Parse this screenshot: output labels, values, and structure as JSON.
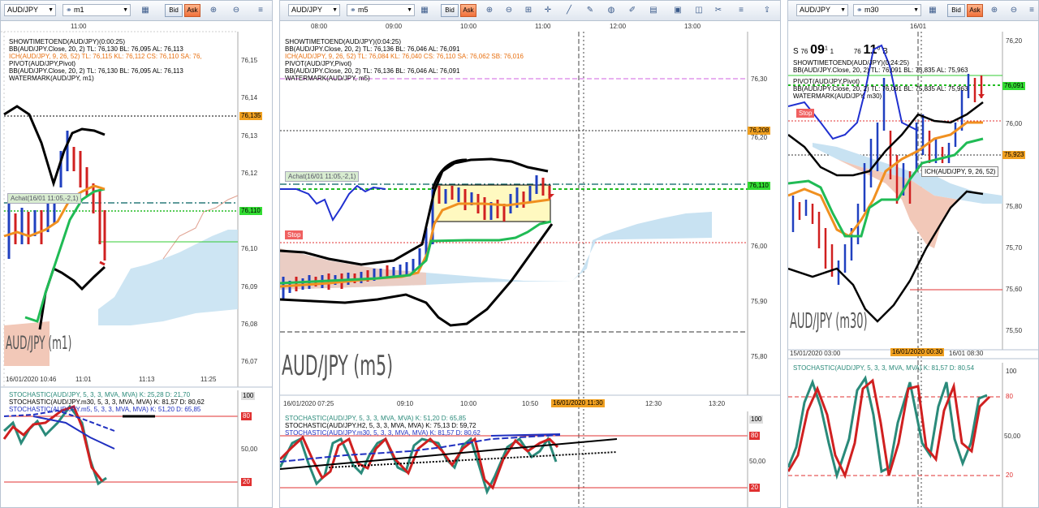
{
  "panels": [
    {
      "symbol": "AUD/JPY",
      "timeframe": "m1",
      "bid": "Bid",
      "ask": "Ask",
      "time_labels": [
        "11:00"
      ],
      "indicators": [
        {
          "text": "SHOWTIMETOEND(AUD/JPY)(0:00:25)",
          "color": "#000000"
        },
        {
          "text": "BB(AUD/JPY.Close, 20, 2)  TL: 76,130  BL: 76,095  AL: 76,113",
          "color": "#000000"
        },
        {
          "text": "ICH(AUD/JPY, 9, 26, 52)  TL: 76,115  KL: 76,112  CS: 76,110  SA: 76,",
          "color": "#e87010"
        },
        {
          "text": "PIVOT(AUD/JPY,Pivot)",
          "color": "#000000"
        },
        {
          "text": "BB(AUD/JPY.Close, 20, 2)  TL: 76,130  BL: 76,095  AL: 76,113",
          "color": "#000000"
        },
        {
          "text": "WATERMARK(AUD/JPY, m1)",
          "color": "#000000"
        }
      ],
      "price_ticks": [
        "76,15",
        "76,14",
        "76,13",
        "76,12",
        "76,11",
        "76,10",
        "76,09",
        "76,08",
        "76,07"
      ],
      "price_tags": [
        {
          "text": "76,135",
          "bg": "#f0a020"
        },
        {
          "text": "76,110",
          "bg": "#33dd33"
        }
      ],
      "achat_label": "Achat(16/01 11:05,-2,1)",
      "watermark": "AUD/JPY (m1)",
      "date_labels": [
        "16/01/2020 10:46",
        "11:01",
        "11:13",
        "11:25"
      ],
      "stoch": [
        {
          "text": "STOCHASTIC(AUD/JPY, 5, 3, 3, MVA, MVA)  K: 25,28  D: 21,70",
          "color": "#2a8a7a"
        },
        {
          "text": "STOCHASTIC(AUD/JPY.m30, 5, 3, 3, MVA, MVA)  K: 81,57  D: 80,62",
          "color": "#000000"
        },
        {
          "text": "STOCHASTIC(AUD/JPY.m5, 5, 3, 3, MVA, MVA)  K: 51,20  D: 65,85",
          "color": "#2030c0"
        }
      ],
      "stoch_ticks": [
        "100",
        "80",
        "50,00",
        "20"
      ]
    },
    {
      "symbol": "AUD/JPY",
      "timeframe": "m5",
      "bid": "Bid",
      "ask": "Ask",
      "time_labels": [
        "08:00",
        "09:00",
        "10:00",
        "11:00",
        "12:00",
        "13:00"
      ],
      "indicators": [
        {
          "text": "SHOWTIMETOEND(AUD/JPY)(0:04:25)",
          "color": "#000000"
        },
        {
          "text": "BB(AUD/JPY.Close, 20, 2)  TL: 76,136  BL: 76,046  AL: 76,091",
          "color": "#000000"
        },
        {
          "text": "ICH(AUD/JPY, 9, 26, 52)  TL: 76,084  KL: 76,040  CS: 76,110  SA: 76,062  SB: 76,016",
          "color": "#e87010"
        },
        {
          "text": "PIVOT(AUD/JPY,Pivot)",
          "color": "#000000"
        },
        {
          "text": "BB(AUD/JPY.Close, 20, 2)  TL: 76,136  BL: 76,046  AL: 76,091",
          "color": "#000000"
        },
        {
          "text": "WATERMARK(AUD/JPY, m5)",
          "color": "#000000"
        }
      ],
      "price_ticks": [
        "76,30",
        "76,20",
        "76,10",
        "76,00",
        "75,90",
        "75,80"
      ],
      "price_tags": [
        {
          "text": "76,208",
          "bg": "#f0a020"
        },
        {
          "text": "76,110",
          "bg": "#33dd33"
        }
      ],
      "achat_label": "Achat(16/01 11:05,-2,1)",
      "stop_label": "Stop",
      "watermark": "AUD/JPY (m5)",
      "date_labels": [
        "16/01/2020 07:25",
        "09:10",
        "10:00",
        "10:50",
        "12:30",
        "13:20"
      ],
      "date_highlight": "16/01/2020 11:30",
      "stoch": [
        {
          "text": "STOCHASTIC(AUD/JPY, 5, 3, 3, MVA, MVA)  K: 51,20  D: 65,85",
          "color": "#2a8a7a"
        },
        {
          "text": "STOCHASTIC(AUD/JPY.H2, 5, 3, 3, MVA, MVA)  K: 75,13  D: 59,72",
          "color": "#000000"
        },
        {
          "text": "STOCHASTIC(AUD/JPY.m30, 5, 3, 3, MVA, MVA)  K: 81,57  D: 80,62",
          "color": "#2030c0"
        }
      ],
      "stoch_ticks": [
        "100",
        "80",
        "50,00",
        "20"
      ]
    },
    {
      "symbol": "AUD/JPY",
      "timeframe": "m30",
      "bid": "Bid",
      "ask": "Ask",
      "time_labels": [
        "16/01"
      ],
      "quote": {
        "s": "S",
        "s_big": "76",
        "s_main": "09",
        "s_sup": "1",
        "s_tail": "1",
        "b_big": "76",
        "b_main": "11",
        "b_sup": "0",
        "b": "B"
      },
      "indicators": [
        {
          "text": "SHOWTIMETOEND(AUD/JPY)(0:24:25)",
          "color": "#000000"
        },
        {
          "text": "BB(AUD/JPY.Close, 20, 2)  TL: 76,091  BL: 75,835  AL: 75,963",
          "color": "#000000"
        },
        {
          "text": "PIVOT(AUD/JPY,Pivot)",
          "color": "#000000"
        },
        {
          "text": "BB(AUD/JPY.Close, 20, 2)  TL: 76,091  BL: 75,835  AL: 75,963",
          "color": "#000000"
        },
        {
          "text": "WATERMARK(AUD/JPY, m30)",
          "color": "#000000"
        }
      ],
      "ich_label": "ICH(AUD/JPY, 9, 26, 52)",
      "price_ticks": [
        "76,20",
        "76,10",
        "76,00",
        "75,90",
        "75,80",
        "75,70",
        "75,60",
        "75,50"
      ],
      "price_tags": [
        {
          "text": "76,091",
          "bg": "#33dd33"
        },
        {
          "text": "75,923",
          "bg": "#f0a020"
        }
      ],
      "stop_label": "Stop",
      "watermark": "AUD/JPY (m30)",
      "date_labels": [
        "15/01/2020 03:00",
        "16/01 08:30"
      ],
      "date_highlight": "16/01/2020 00:30",
      "stoch": [
        {
          "text": "STOCHASTIC(AUD/JPY, 5, 3, 3, MVA, MVA)  K: 81,57  D: 80,54",
          "color": "#2a8a7a"
        }
      ],
      "stoch_ticks": [
        "100",
        "80",
        "50,00",
        "20"
      ]
    }
  ]
}
